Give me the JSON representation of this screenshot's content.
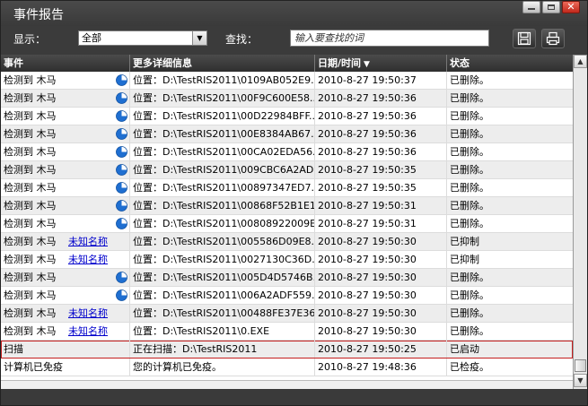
{
  "window": {
    "title": "事件报告",
    "controls": {
      "minimize": "minimize",
      "maximize": "maximize",
      "close": "close"
    }
  },
  "toolbar": {
    "show_label": "显示：",
    "show_value": "全部",
    "find_label": "查找：",
    "search_placeholder": "输入要查找的词",
    "save_icon": "save-icon",
    "print_icon": "print-icon"
  },
  "table": {
    "headers": {
      "event": "事件",
      "details": "更多详细信息",
      "datetime": "日期/时间",
      "status": "状态"
    },
    "sort_indicator": "▼",
    "rows": [
      {
        "event": "检测到 木马",
        "name": "",
        "pie": true,
        "details": "位置：D:\\TestRIS2011\\0109AB052E9...",
        "datetime": "2010-8-27 19:50:37",
        "status": "已删除。"
      },
      {
        "event": "检测到 木马",
        "name": "",
        "pie": true,
        "details": "位置：D:\\TestRIS2011\\00F9C600E58...",
        "datetime": "2010-8-27 19:50:36",
        "status": "已删除。"
      },
      {
        "event": "检测到 木马",
        "name": "",
        "pie": true,
        "details": "位置：D:\\TestRIS2011\\00D22984BFF...",
        "datetime": "2010-8-27 19:50:36",
        "status": "已删除。"
      },
      {
        "event": "检测到 木马",
        "name": "",
        "pie": true,
        "details": "位置：D:\\TestRIS2011\\00E8384AB67...",
        "datetime": "2010-8-27 19:50:36",
        "status": "已删除。"
      },
      {
        "event": "检测到 木马",
        "name": "",
        "pie": true,
        "details": "位置：D:\\TestRIS2011\\00CA02EDA56...",
        "datetime": "2010-8-27 19:50:36",
        "status": "已删除。"
      },
      {
        "event": "检测到 木马",
        "name": "",
        "pie": true,
        "details": "位置：D:\\TestRIS2011\\009CBC6A2AD...",
        "datetime": "2010-8-27 19:50:35",
        "status": "已删除。"
      },
      {
        "event": "检测到 木马",
        "name": "",
        "pie": true,
        "details": "位置：D:\\TestRIS2011\\00897347ED7...",
        "datetime": "2010-8-27 19:50:35",
        "status": "已删除。"
      },
      {
        "event": "检测到 木马",
        "name": "",
        "pie": true,
        "details": "位置：D:\\TestRIS2011\\00868F52B1E1...",
        "datetime": "2010-8-27 19:50:31",
        "status": "已删除。"
      },
      {
        "event": "检测到 木马",
        "name": "",
        "pie": true,
        "details": "位置：D:\\TestRIS2011\\00808922009E...",
        "datetime": "2010-8-27 19:50:31",
        "status": "已删除。"
      },
      {
        "event": "检测到 木马",
        "name": "未知名称",
        "pie": false,
        "details": "位置：D:\\TestRIS2011\\005586D09E8...",
        "datetime": "2010-8-27 19:50:30",
        "status": "已抑制"
      },
      {
        "event": "检测到 木马",
        "name": "未知名称",
        "pie": false,
        "details": "位置：D:\\TestRIS2011\\0027130C36D...",
        "datetime": "2010-8-27 19:50:30",
        "status": "已抑制"
      },
      {
        "event": "检测到 木马",
        "name": "",
        "pie": true,
        "details": "位置：D:\\TestRIS2011\\005D4D5746B...",
        "datetime": "2010-8-27 19:50:30",
        "status": "已删除。"
      },
      {
        "event": "检测到 木马",
        "name": "",
        "pie": true,
        "details": "位置：D:\\TestRIS2011\\006A2ADF559...",
        "datetime": "2010-8-27 19:50:30",
        "status": "已删除。"
      },
      {
        "event": "检测到 木马",
        "name": "未知名称",
        "pie": false,
        "details": "位置：D:\\TestRIS2011\\00488FE37E36...",
        "datetime": "2010-8-27 19:50:30",
        "status": "已删除。"
      },
      {
        "event": "检测到 木马",
        "name": "未知名称",
        "pie": false,
        "details": "位置：D:\\TestRIS2011\\0.EXE",
        "datetime": "2010-8-27 19:50:30",
        "status": "已删除。"
      },
      {
        "event": "扫描",
        "name": "",
        "pie": false,
        "details": "正在扫描：D:\\TestRIS2011",
        "datetime": "2010-8-27 19:50:25",
        "status": "已启动",
        "selected": true
      },
      {
        "event": "计算机已免疫",
        "name": "",
        "pie": false,
        "details": "您的计算机已免疫。",
        "datetime": "2010-8-27 19:48:36",
        "status": "已检疫。"
      }
    ]
  },
  "colors": {
    "window_bg": "#3b3b3b",
    "link": "#0000cc",
    "selection_border": "#c41f1f",
    "pie_blue": "#1f6fd1"
  }
}
